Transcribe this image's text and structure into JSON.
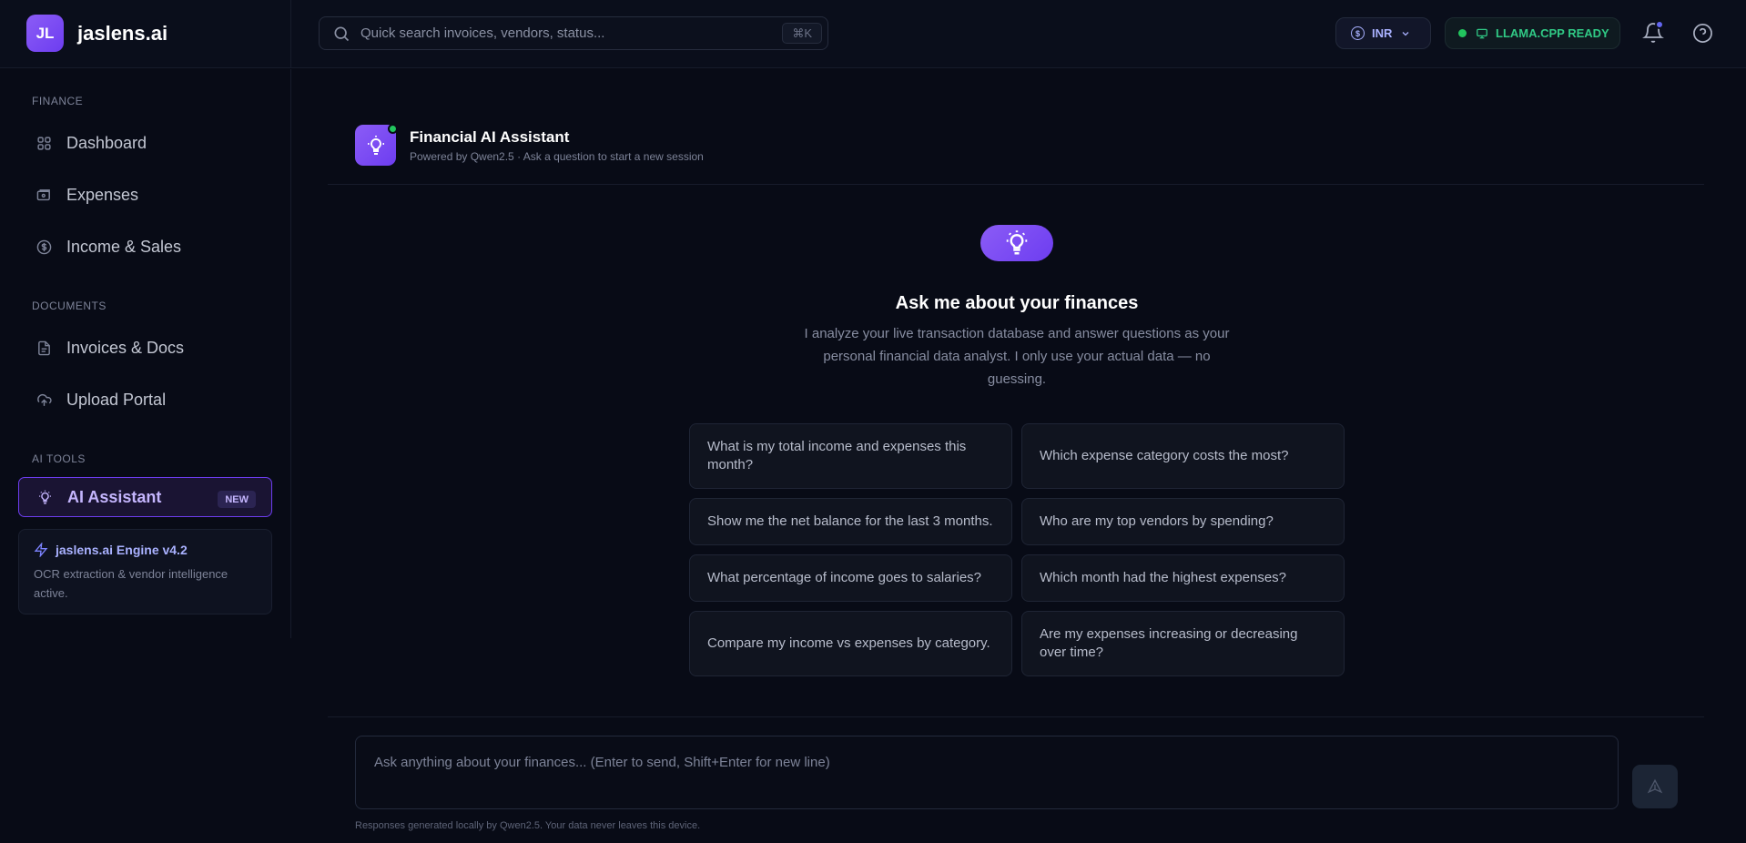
{
  "brand": {
    "logo_text": "JL",
    "name": "jaslens.ai"
  },
  "search": {
    "placeholder": "Quick search invoices, vendors, status...",
    "shortcut": "⌘K"
  },
  "header": {
    "currency": "INR",
    "engine_status": "LLAMA.CPP READY"
  },
  "sidebar": {
    "sections": [
      {
        "label": "FINANCE"
      },
      {
        "label": "DOCUMENTS"
      },
      {
        "label": "AI TOOLS"
      }
    ],
    "items": [
      {
        "label": "Dashboard",
        "icon": "grid-icon"
      },
      {
        "label": "Expenses",
        "icon": "wallet-icon"
      },
      {
        "label": "Income & Sales",
        "icon": "dollar-circle-icon"
      },
      {
        "label": "Invoices & Docs",
        "icon": "document-icon"
      },
      {
        "label": "Upload Portal",
        "icon": "cloud-upload-icon"
      },
      {
        "label": "AI Assistant",
        "icon": "lightbulb-icon",
        "badge": "NEW",
        "active": true
      }
    ],
    "engine_card": {
      "title": "jaslens.ai Engine v4.2",
      "desc": "OCR extraction & vendor intelligence active."
    }
  },
  "assistant": {
    "title": "Financial AI Assistant",
    "subtitle": "Powered by Qwen2.5 · Ask a question to start a new session"
  },
  "hero": {
    "title": "Ask me about your finances",
    "desc": "I analyze your live transaction database and answer questions as your personal financial data analyst. I only use your actual data — no guessing."
  },
  "suggestions": [
    "What is my total income and expenses this month?",
    "Which expense category costs the most?",
    "Show me the net balance for the last 3 months.",
    "Who are my top vendors by spending?",
    "What percentage of income goes to salaries?",
    "Which month had the highest expenses?",
    "Compare my income vs expenses by category.",
    "Are my expenses increasing or decreasing over time?"
  ],
  "composer": {
    "placeholder": "Ask anything about your finances... (Enter to send, Shift+Enter for new line)"
  },
  "footnote": "Responses generated locally by Qwen2.5. Your data never leaves this device.",
  "colors": {
    "background": "#080b16",
    "accent": "#8b5cf6",
    "status_green": "#22c55e",
    "currency_text": "#a9b1ff"
  }
}
